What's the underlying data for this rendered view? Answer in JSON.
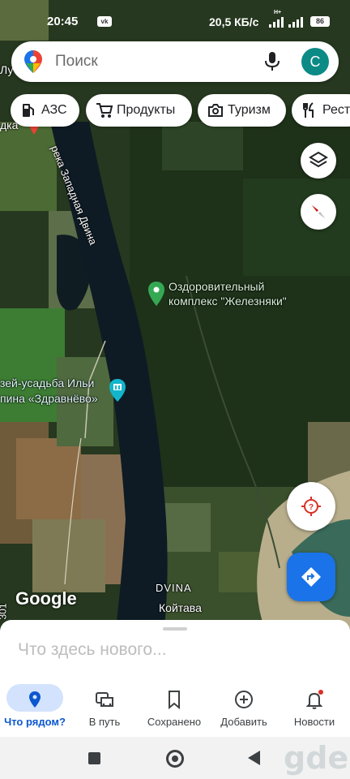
{
  "status_bar": {
    "time": "20:45",
    "vk_badge": "vk",
    "network_speed": "20,5 КБ/с",
    "signal_label": "H+",
    "battery": "86"
  },
  "search": {
    "placeholder": "Поиск",
    "avatar_letter": "C"
  },
  "chips": [
    {
      "label": "АЗС",
      "icon": "gas-station-icon"
    },
    {
      "label": "Продукты",
      "icon": "shopping-cart-icon"
    },
    {
      "label": "Туризм",
      "icon": "camera-icon"
    },
    {
      "label": "Рест",
      "icon": "restaurant-icon"
    }
  ],
  "map": {
    "river_label": "река Западная Двина",
    "poi_health": "Оздоровительный комплекс \"Железняки\"",
    "poi_health_line1": "Оздоровительный",
    "poi_health_line2": "комплекс \"Железняки\"",
    "poi_museum_line1": "зей-усадьба Ильи",
    "poi_museum_line2": "пина «Здравнёво»",
    "edge_label_top": "дка",
    "edge_label_top2": "Лу",
    "dvina_label": "DVINA",
    "koitava_label": "Койтава",
    "google_logo": "Google",
    "vertical_label": "301"
  },
  "bottom_sheet": {
    "title": "Что здесь нового..."
  },
  "bottom_nav": [
    {
      "label": "Что рядом?",
      "icon": "location-pin-icon",
      "active": true
    },
    {
      "label": "В путь",
      "icon": "commute-icon",
      "active": false
    },
    {
      "label": "Сохранено",
      "icon": "bookmark-icon",
      "active": false
    },
    {
      "label": "Добавить",
      "icon": "add-circle-icon",
      "active": false
    },
    {
      "label": "Новости",
      "icon": "bell-icon",
      "active": false
    }
  ],
  "watermark": "gde",
  "colors": {
    "accent_blue": "#1a73e8",
    "avatar_teal": "#0c8a86",
    "active_pill": "#d3e3fd",
    "poi_green": "#34a853",
    "poi_teal": "#12b5cb"
  }
}
